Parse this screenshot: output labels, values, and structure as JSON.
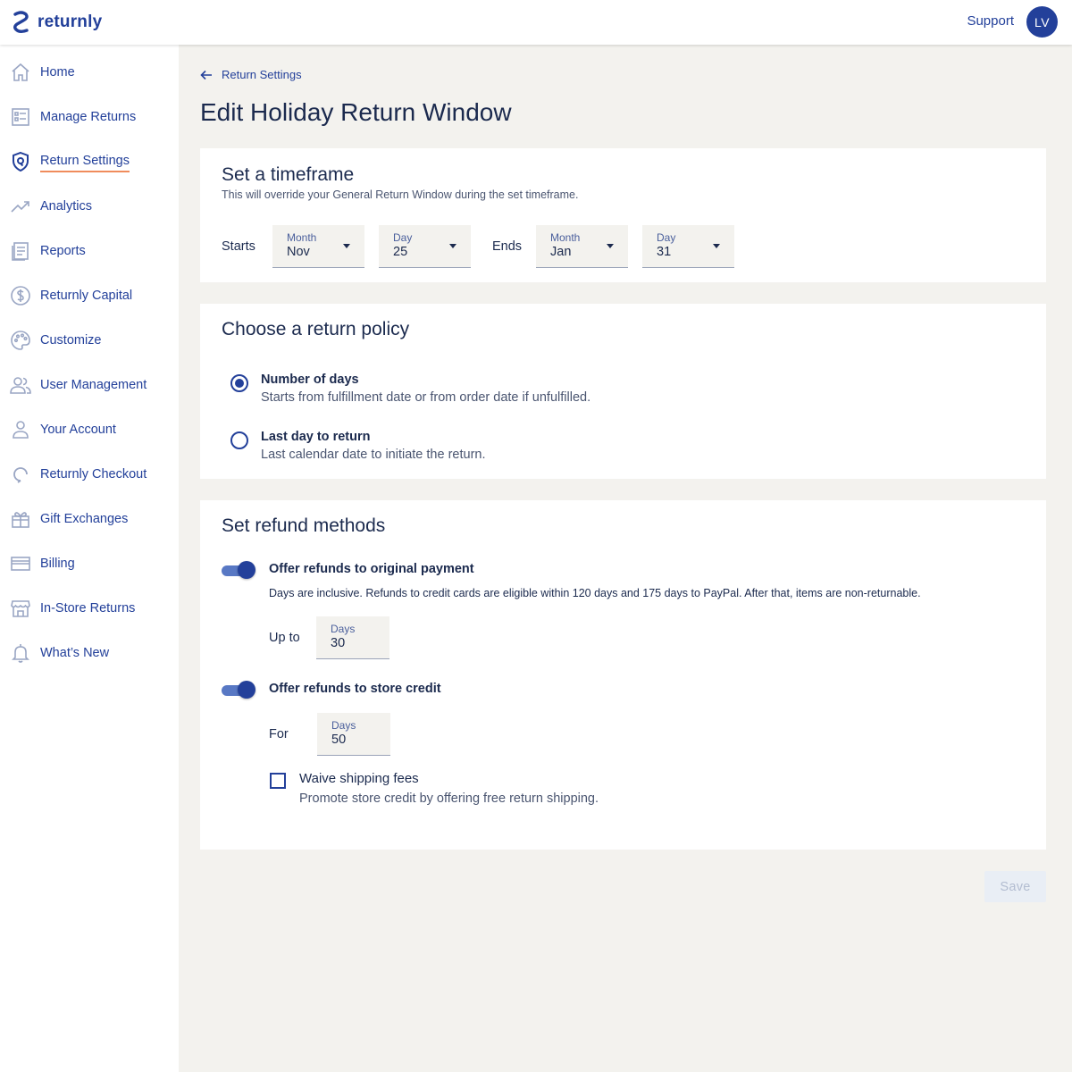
{
  "app": {
    "brand": "returnly",
    "brand_color": "#23409a",
    "accent_underline_color": "#f08c5c"
  },
  "header": {
    "support_label": "Support",
    "avatar_initials": "LV"
  },
  "sidebar": {
    "items": [
      {
        "label": "Home",
        "icon": "home-icon",
        "active": false
      },
      {
        "label": "Manage Returns",
        "icon": "list-icon",
        "active": false
      },
      {
        "label": "Return Settings",
        "icon": "shield-icon",
        "active": true
      },
      {
        "label": "Analytics",
        "icon": "trend-icon",
        "active": false
      },
      {
        "label": "Reports",
        "icon": "report-icon",
        "active": false
      },
      {
        "label": "Returnly Capital",
        "icon": "dollar-icon",
        "active": false
      },
      {
        "label": "Customize",
        "icon": "palette-icon",
        "active": false
      },
      {
        "label": "User Management",
        "icon": "users-icon",
        "active": false
      },
      {
        "label": "Your Account",
        "icon": "person-icon",
        "active": false
      },
      {
        "label": "Returnly Checkout",
        "icon": "refresh-icon",
        "active": false
      },
      {
        "label": "Gift Exchanges",
        "icon": "gift-icon",
        "active": false
      },
      {
        "label": "Billing",
        "icon": "card-icon",
        "active": false
      },
      {
        "label": "In-Store Returns",
        "icon": "store-icon",
        "active": false
      },
      {
        "label": "What’s New",
        "icon": "bell-icon",
        "active": false
      }
    ]
  },
  "main": {
    "back_label": "Return Settings",
    "title": "Edit Holiday Return Window",
    "timeframe": {
      "title": "Set a timeframe",
      "subtitle": "This will override your General Return Window during the set timeframe.",
      "starts_label": "Starts",
      "ends_label": "Ends",
      "start_month": {
        "label": "Month",
        "value": "Nov"
      },
      "start_day": {
        "label": "Day",
        "value": "25"
      },
      "end_month": {
        "label": "Month",
        "value": "Jan"
      },
      "end_day": {
        "label": "Day",
        "value": "31"
      }
    },
    "policy": {
      "title": "Choose a return policy",
      "options": [
        {
          "title": "Number of days",
          "desc": "Starts from fulfillment date or from order date if unfulfilled.",
          "checked": true
        },
        {
          "title": "Last day to return",
          "desc": "Last calendar date to initiate the return.",
          "checked": false
        }
      ]
    },
    "refunds": {
      "title": "Set refund methods",
      "original": {
        "title": "Offer refunds to original payment",
        "desc": "Days are inclusive. Refunds to credit cards are eligible within 120 days and 175 days to PayPal. After that, items are non-returnable.",
        "enabled": true,
        "prefix": "Up to",
        "field_label": "Days",
        "field_value": "30"
      },
      "store_credit": {
        "title": "Offer refunds to store credit",
        "enabled": true,
        "prefix": "For",
        "field_label": "Days",
        "field_value": "50"
      },
      "waive": {
        "title": "Waive shipping fees",
        "desc": "Promote store credit by offering free return shipping.",
        "checked": false
      }
    },
    "save_label": "Save"
  }
}
